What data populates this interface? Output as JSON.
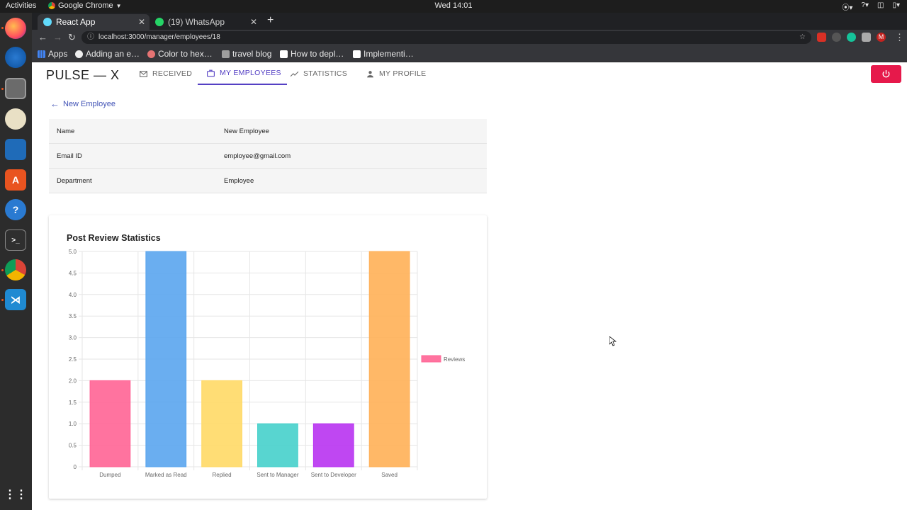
{
  "system": {
    "activities": "Activities",
    "app_name": "Google Chrome",
    "clock": "Wed 14:01"
  },
  "browser": {
    "tabs": [
      {
        "title": "React App",
        "active": true
      },
      {
        "title": "(19) WhatsApp",
        "active": false
      }
    ],
    "url": "localhost:3000/manager/employees/18",
    "bookmarks": [
      "Apps",
      "Adding an e…",
      "Color to hex…",
      "travel blog",
      "How to depl…",
      "Implementi…"
    ]
  },
  "app": {
    "brand": "PULSE — X",
    "nav": [
      {
        "label": "RECEIVED",
        "icon": "mail-icon",
        "active": false
      },
      {
        "label": "MY EMPLOYEES",
        "icon": "briefcase-icon",
        "active": true
      },
      {
        "label": "STATISTICS",
        "icon": "trend-icon",
        "active": false
      },
      {
        "label": "MY PROFILE",
        "icon": "person-icon",
        "active": false
      }
    ],
    "back_label": "New Employee",
    "details": [
      {
        "label": "Name",
        "value": "New Employee"
      },
      {
        "label": "Email ID",
        "value": "employee@gmail.com"
      },
      {
        "label": "Department",
        "value": "Employee"
      }
    ],
    "chart_title": "Post Review Statistics"
  },
  "chart_data": {
    "type": "bar",
    "title": "Post Review Statistics",
    "categories": [
      "Dumped",
      "Marked as Read",
      "Replied",
      "Sent to Manager",
      "Sent to Developer",
      "Saved"
    ],
    "series": [
      {
        "name": "Reviews",
        "values": [
          2,
          5,
          2,
          1,
          1,
          5
        ]
      }
    ],
    "colors": [
      "#ff6495",
      "#5aa5ee",
      "#ffd966",
      "#46d0cb",
      "#b833f1",
      "#ffb057"
    ],
    "ylim": [
      0,
      5
    ],
    "yticks": [
      "0",
      "0.5",
      "1.0",
      "1.5",
      "2.0",
      "2.5",
      "3.0",
      "3.5",
      "4.0",
      "4.5",
      "5.0"
    ],
    "legend_position": "right",
    "grid": true
  }
}
